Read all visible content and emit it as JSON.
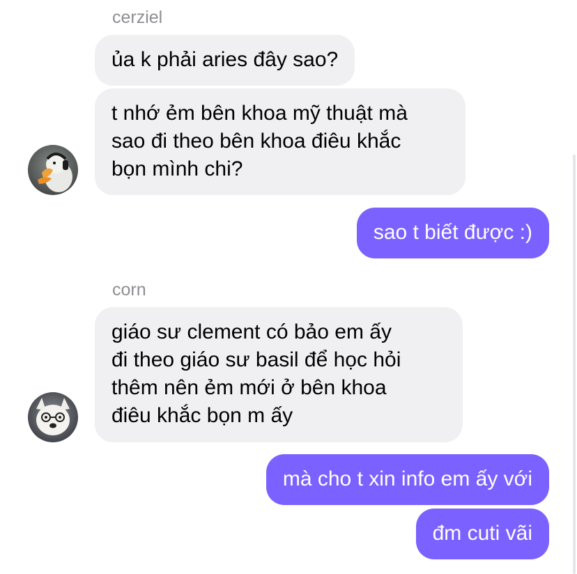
{
  "chat": {
    "groups": [
      {
        "sender": "cerziel",
        "avatar_icon": "duck-headphones-avatar-icon",
        "messages": [
          {
            "lines": [
              "ủa k phải aries đây sao?"
            ]
          },
          {
            "lines": [
              "t nhớ ẻm bên khoa mỹ thuật mà",
              "sao đi theo bên khoa điêu khắc",
              "bọn mình chi?"
            ]
          }
        ]
      },
      {
        "sender": "me",
        "messages": [
          {
            "lines": [
              "sao t biết được :)"
            ]
          }
        ]
      },
      {
        "sender": "corn",
        "avatar_icon": "dog-glasses-avatar-icon",
        "messages": [
          {
            "lines": [
              "giáo sư clement có bảo em ấy",
              "đi theo giáo sư basil để học hỏi",
              "thêm nên ẻm mới ở bên khoa",
              "điêu khắc bọn m ấy"
            ]
          }
        ]
      },
      {
        "sender": "me",
        "messages": [
          {
            "lines": [
              "mà cho t xin info em ấy với"
            ]
          },
          {
            "lines": [
              "đm cuti vãi"
            ]
          }
        ]
      }
    ]
  },
  "colors": {
    "incoming_bubble": "#f0f0f3",
    "outgoing_bubble": "#7b61ff",
    "sender_name": "#8e8e93"
  }
}
